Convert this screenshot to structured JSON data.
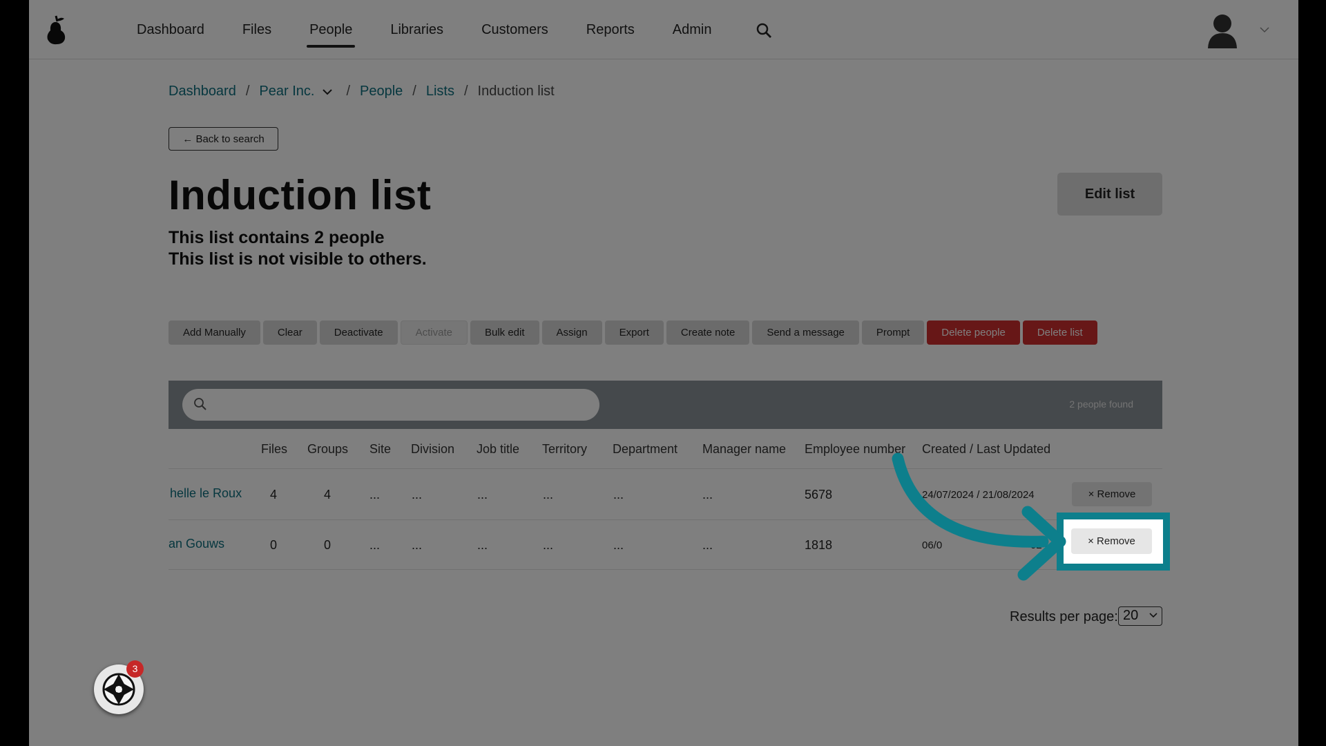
{
  "nav": {
    "items": [
      "Dashboard",
      "Files",
      "People",
      "Libraries",
      "Customers",
      "Reports",
      "Admin"
    ],
    "active": "People"
  },
  "breadcrumb": {
    "dashboard": "Dashboard",
    "org": "Pear Inc.",
    "people": "People",
    "lists": "Lists",
    "current": "Induction list",
    "sep": "/"
  },
  "back_label": "← Back to search",
  "page": {
    "title": "Induction list",
    "count_text": "This list contains 2 people",
    "visibility_text": "This list is not visible to others.",
    "edit_label": "Edit list"
  },
  "toolbar": {
    "add_manually": "Add Manually",
    "clear": "Clear",
    "deactivate": "Deactivate",
    "activate": "Activate",
    "bulk_edit": "Bulk edit",
    "assign": "Assign",
    "export": "Export",
    "create_note": "Create note",
    "send_message": "Send a message",
    "prompt": "Prompt",
    "delete_people": "Delete people",
    "delete_list": "Delete list"
  },
  "search": {
    "placeholder": "",
    "results": "2 people found"
  },
  "table": {
    "headers": {
      "files": "Files",
      "groups": "Groups",
      "site": "Site",
      "division": "Division",
      "job_title": "Job title",
      "territory": "Territory",
      "department": "Department",
      "manager": "Manager name",
      "employee_number": "Employee number",
      "created": "Created / Last Updated"
    },
    "rows": [
      {
        "name": "helle le Roux",
        "files": "4",
        "groups": "4",
        "site": "...",
        "division": "...",
        "job_title": "...",
        "territory": "...",
        "department": "...",
        "manager": "...",
        "employee_number": "5678",
        "created": "24/07/2024 / 21/08/2024",
        "remove": "×  Remove"
      },
      {
        "name": "an Gouws",
        "files": "0",
        "groups": "0",
        "site": "...",
        "division": "...",
        "job_title": "...",
        "territory": "...",
        "department": "...",
        "manager": "...",
        "employee_number": "1818",
        "created_left": "06/0",
        "created_right": "024",
        "remove": "×  Remove"
      }
    ]
  },
  "pagination": {
    "label": "Results per page:",
    "value": "20"
  },
  "widget": {
    "badge": "3"
  },
  "colors": {
    "accent": "#0d7f8c",
    "link": "#0d6e7e",
    "danger": "#cf2e2e"
  }
}
